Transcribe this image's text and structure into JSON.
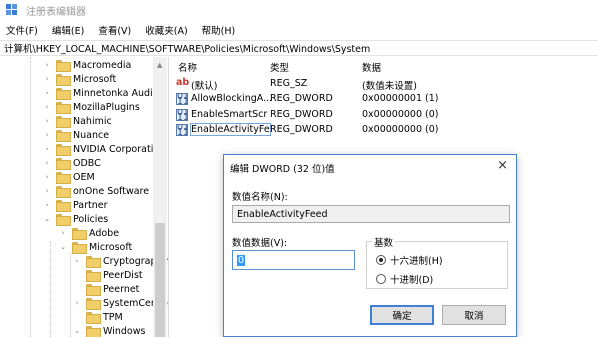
{
  "window": {
    "title": "注册表编辑器"
  },
  "menu": [
    "文件(F)",
    "编辑(E)",
    "查看(V)",
    "收藏夹(A)",
    "帮助(H)"
  ],
  "address": "计算机\\HKEY_LOCAL_MACHINE\\SOFTWARE\\Policies\\Microsoft\\Windows\\System",
  "tree": [
    {
      "label": "Macromedia",
      "arrow": "›"
    },
    {
      "label": "Microsoft",
      "arrow": "›"
    },
    {
      "label": "Minnetonka Audio S",
      "arrow": "›"
    },
    {
      "label": "MozillaPlugins",
      "arrow": "›"
    },
    {
      "label": "Nahimic",
      "arrow": "›"
    },
    {
      "label": "Nuance",
      "arrow": "›"
    },
    {
      "label": "NVIDIA Corporation",
      "arrow": "›"
    },
    {
      "label": "ODBC",
      "arrow": "›"
    },
    {
      "label": "OEM",
      "arrow": "›"
    },
    {
      "label": "onOne Software",
      "arrow": "›"
    },
    {
      "label": "Partner",
      "arrow": "›"
    },
    {
      "label": "Policies",
      "arrow": "⌄"
    },
    {
      "label": "Adobe",
      "arrow": "›"
    },
    {
      "label": "Microsoft",
      "arrow": "⌄"
    },
    {
      "label": "Cryptography",
      "arrow": "›"
    },
    {
      "label": "PeerDist",
      "arrow": ""
    },
    {
      "label": "Peernet",
      "arrow": ""
    },
    {
      "label": "SystemCertific",
      "arrow": "›"
    },
    {
      "label": "TPM",
      "arrow": ""
    },
    {
      "label": "Windows",
      "arrow": "⌄"
    }
  ],
  "columns": {
    "name": "名称",
    "type": "类型",
    "data": "数据"
  },
  "values": [
    {
      "icon": "ab",
      "name": "(默认)",
      "type": "REG_SZ",
      "data": "(数值未设置)"
    },
    {
      "icon": "bin",
      "name": "AllowBlockingA...",
      "type": "REG_DWORD",
      "data": "0x00000001 (1)"
    },
    {
      "icon": "bin",
      "name": "EnableSmartScr",
      "type": "REG_DWORD",
      "data": "0x00000000 (0)"
    },
    {
      "icon": "bin",
      "name": "EnableActivityFe",
      "type": "REG_DWORD",
      "data": "0x00000000 (0)"
    }
  ],
  "dialog": {
    "title": "编辑 DWORD (32 位)值",
    "close": "×",
    "name_label": "数值名称(N):",
    "name_value": "EnableActivityFeed",
    "data_label": "数值数据(V):",
    "data_value": "0",
    "base_label": "基数",
    "base_hex": "十六进制(H)",
    "base_dec": "十进制(D)",
    "ok": "确定",
    "cancel": "取消"
  }
}
